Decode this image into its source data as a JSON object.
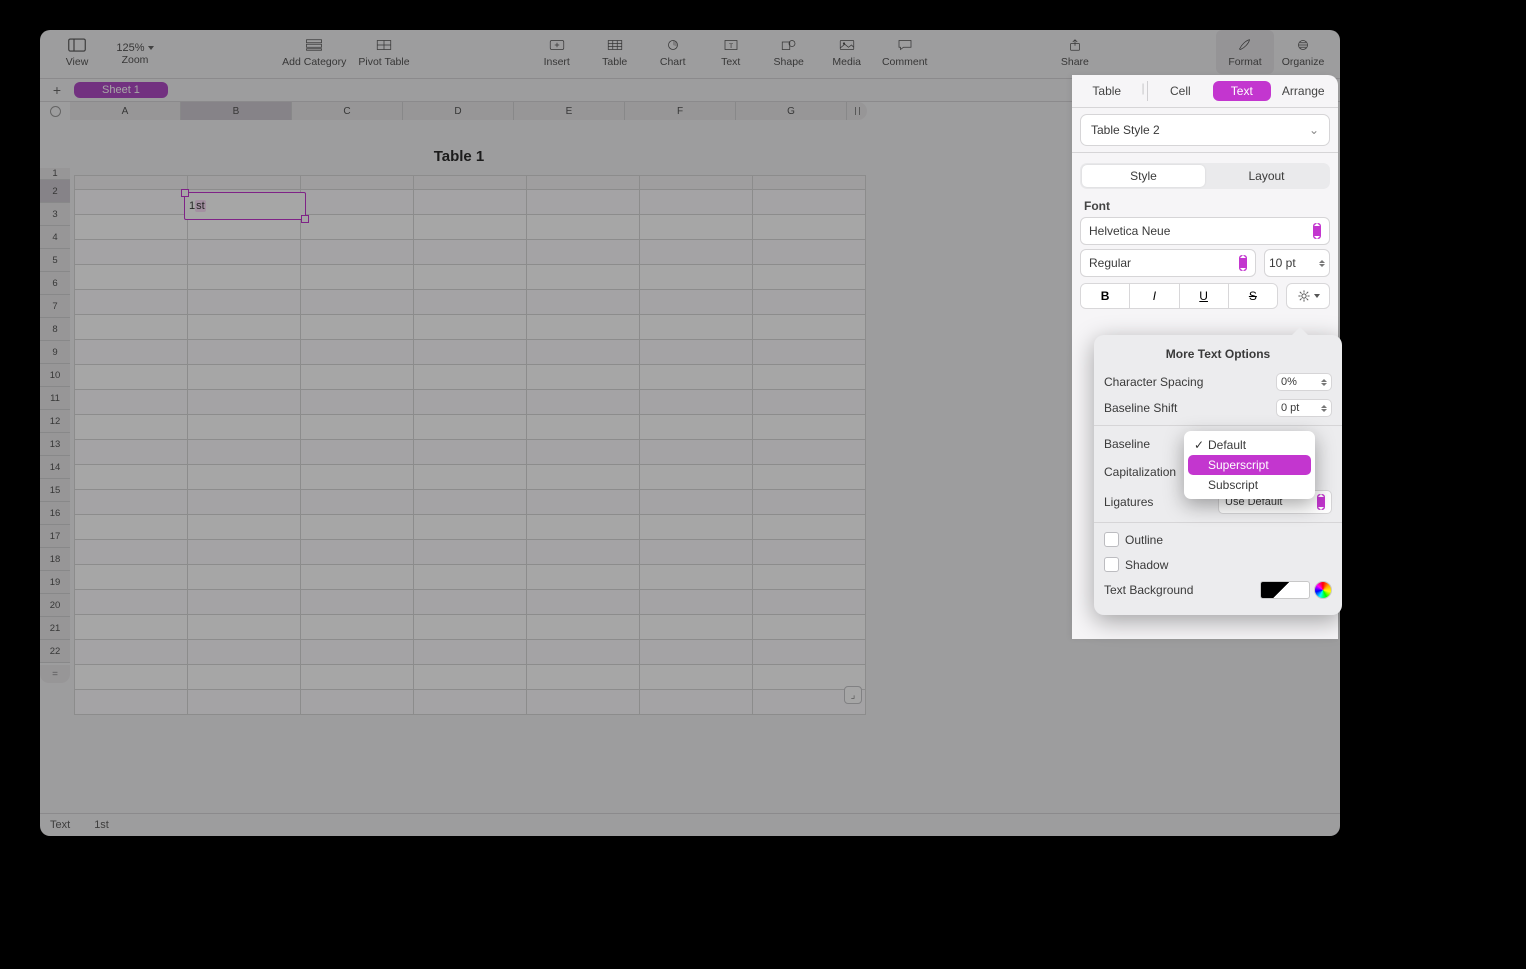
{
  "toolbar": {
    "view": "View",
    "zoom": "Zoom",
    "zoom_value": "125%",
    "add_category": "Add Category",
    "pivot": "Pivot Table",
    "insert": "Insert",
    "table": "Table",
    "chart": "Chart",
    "text": "Text",
    "shape": "Shape",
    "media": "Media",
    "comment": "Comment",
    "share": "Share",
    "format": "Format",
    "organize": "Organize"
  },
  "sheet_tab": "Sheet 1",
  "table_title": "Table 1",
  "columns": [
    "A",
    "B",
    "C",
    "D",
    "E",
    "F",
    "G"
  ],
  "rows": [
    "1",
    "2",
    "3",
    "4",
    "5",
    "6",
    "7",
    "8",
    "9",
    "10",
    "11",
    "12",
    "13",
    "14",
    "15",
    "16",
    "17",
    "18",
    "19",
    "20",
    "21",
    "22"
  ],
  "editing_cell": {
    "prefix": "1",
    "selection": "st"
  },
  "status": {
    "mode": "Text",
    "value": "1st"
  },
  "inspector": {
    "tabs": {
      "table": "Table",
      "cell": "Cell",
      "text": "Text",
      "arrange": "Arrange"
    },
    "style_name": "Table Style 2",
    "seg": {
      "style": "Style",
      "layout": "Layout"
    },
    "font_label": "Font",
    "font_family": "Helvetica Neue",
    "font_weight": "Regular",
    "font_size": "10 pt",
    "buttons": {
      "b": "B",
      "i": "I",
      "u": "U",
      "s": "S"
    }
  },
  "popover": {
    "title": "More Text Options",
    "char_spacing_label": "Character Spacing",
    "char_spacing_value": "0%",
    "baseline_shift_label": "Baseline Shift",
    "baseline_shift_value": "0 pt",
    "baseline_label": "Baseline",
    "capitalization_label": "Capitalization",
    "ligatures_label": "Ligatures",
    "ligatures_value": "Use Default",
    "outline": "Outline",
    "shadow": "Shadow",
    "text_bg": "Text Background"
  },
  "baseline_menu": {
    "default": "Default",
    "superscript": "Superscript",
    "subscript": "Subscript"
  }
}
